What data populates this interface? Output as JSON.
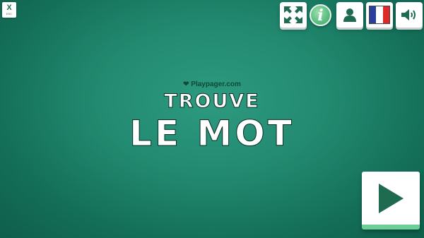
{
  "top_left": {
    "close_label": "X",
    "key_hint": "ESC"
  },
  "toolbar": {
    "fullscreen_icon": "fullscreen-icon",
    "info_label": "i",
    "profile_icon": "user-icon",
    "language_icon": "french-flag-icon",
    "sound_icon": "speaker-icon"
  },
  "splash": {
    "credit": "Playpager.com",
    "title_line1": "TROUVE",
    "title_line2": "LE MOT"
  },
  "colors": {
    "background": "#228a70",
    "accent": "#1e6b50",
    "play_bar": "#6ccf9a"
  }
}
